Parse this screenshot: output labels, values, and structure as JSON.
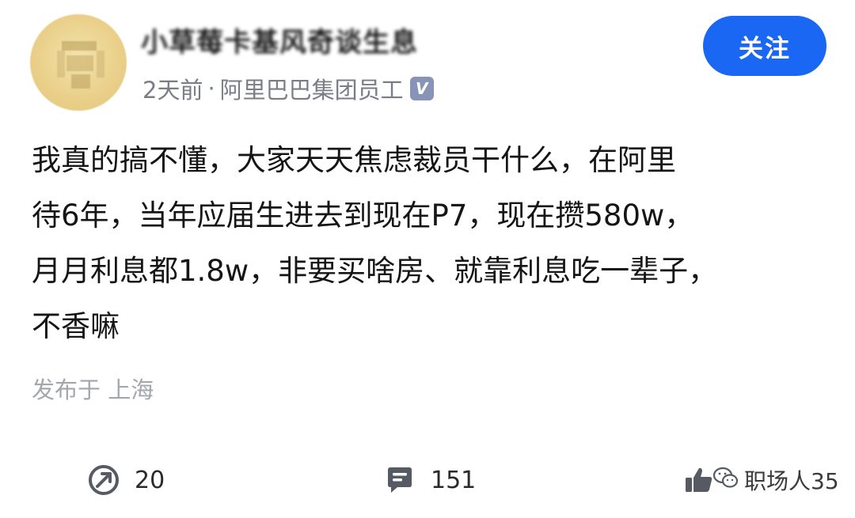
{
  "header": {
    "username": "小草莓卡基风奇谈生息",
    "time": "2天前",
    "separator": "·",
    "company": "阿里巴巴集团员工",
    "verified_icon": "verified-badge-icon",
    "follow_label": "关注",
    "follow_color": "#1967f2"
  },
  "post": {
    "lines": [
      "我真的搞不懂，大家天天焦虑裁员干什么，在阿里",
      "待6年，当年应届生进去到现在P7，现在攒580w，",
      "月月利息都1.8w，非要买啥房、就靠利息吃一辈子，",
      "不香嘛"
    ],
    "location": "发布于 上海"
  },
  "actions": {
    "share": {
      "icon": "share-icon",
      "count": "20"
    },
    "comment": {
      "icon": "comment-icon",
      "count": "151"
    },
    "like": {
      "icon": "thumbs-up-icon"
    }
  },
  "watermark": {
    "icon": "wechat-icon",
    "text": "职场人35"
  }
}
